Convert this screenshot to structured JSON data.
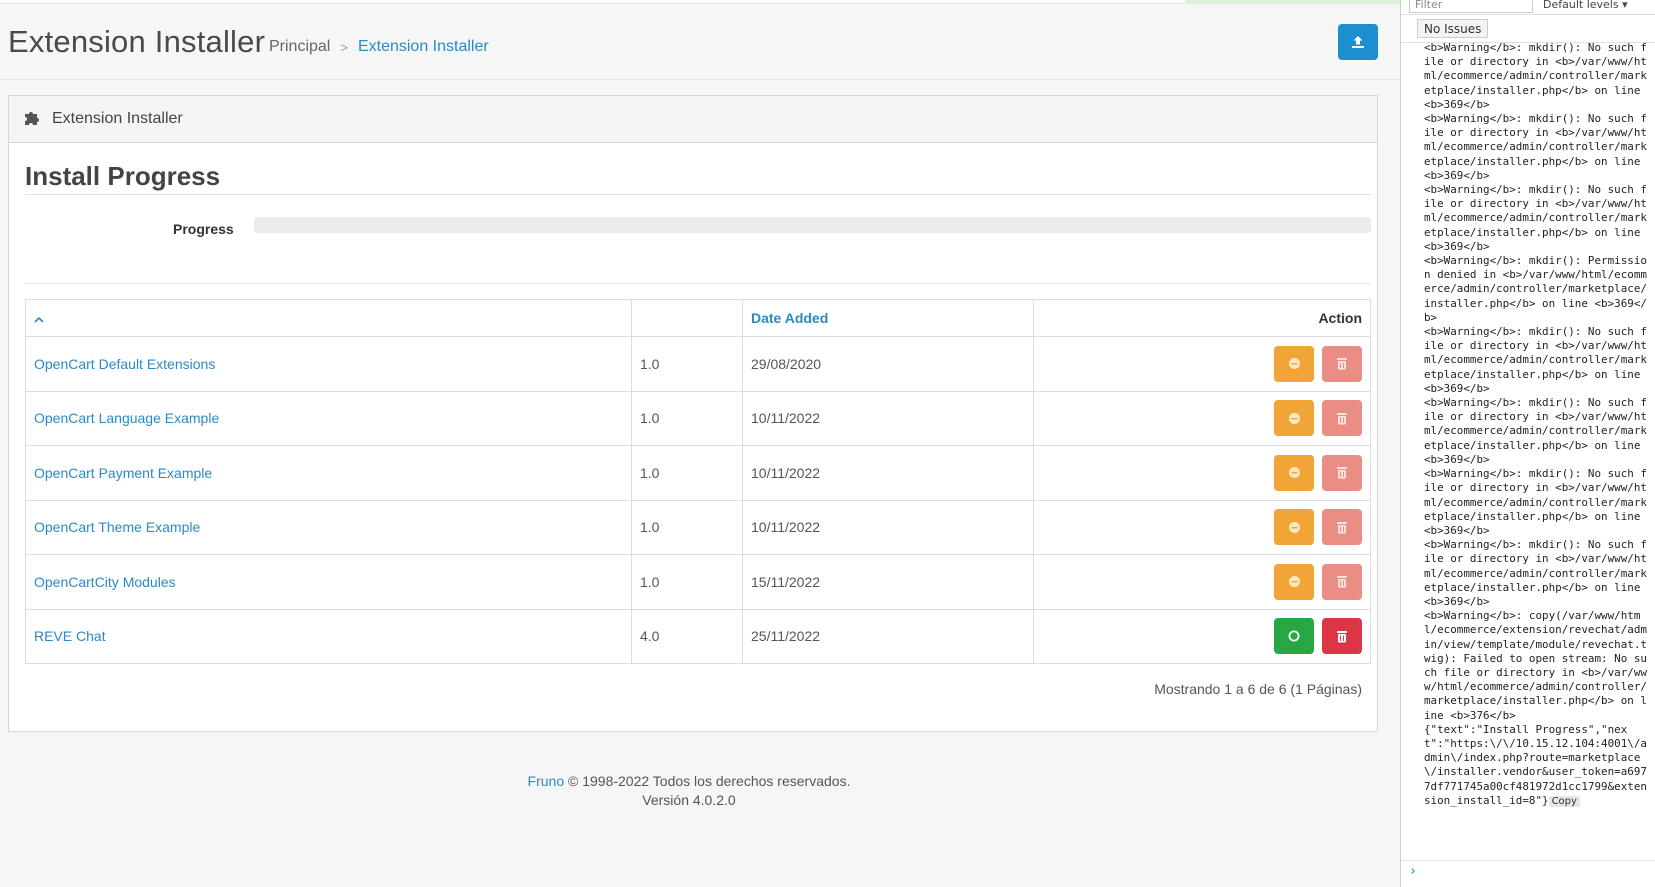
{
  "header": {
    "title": "Extension Installer",
    "breadcrumb": [
      {
        "label": "Principal"
      },
      {
        "label": "Extension Installer"
      }
    ],
    "upload_icon": "upload-icon"
  },
  "card": {
    "header_title": "Extension Installer",
    "header_icon": "puzzle-icon",
    "section_title": "Install Progress",
    "progress_label": "Progress",
    "progress_value": 0
  },
  "table": {
    "columns": {
      "name_sort_icon": "chevron-up-icon",
      "version": "",
      "date_added": "Date Added",
      "action": "Action"
    },
    "rows": [
      {
        "name": "OpenCart Default Extensions",
        "version": "1.0",
        "date": "29/08/2020",
        "installed": false
      },
      {
        "name": "OpenCart Language Example",
        "version": "1.0",
        "date": "10/11/2022",
        "installed": false
      },
      {
        "name": "OpenCart Payment Example",
        "version": "1.0",
        "date": "10/11/2022",
        "installed": false
      },
      {
        "name": "OpenCart Theme Example",
        "version": "1.0",
        "date": "10/11/2022",
        "installed": false
      },
      {
        "name": "OpenCartCity Modules",
        "version": "1.0",
        "date": "15/11/2022",
        "installed": false
      },
      {
        "name": "REVE Chat",
        "version": "4.0",
        "date": "25/11/2022",
        "installed": true
      }
    ],
    "pagination_info": "Mostrando 1 a 6 de 6 (1 Páginas)"
  },
  "footer": {
    "brand_link": "Fruno",
    "copyright": "© 1998-2022 Todos los derechos reservados.",
    "version": "Versión 4.0.2.0"
  },
  "devtools": {
    "filter_placeholder": "Filter",
    "levels": "Default levels ▾",
    "issues": "No Issues",
    "log_text": "<b>Warning</b>: mkdir(): No such file or directory in <b>/var/www/html/ecommerce/admin/controller/marketplace/installer.php</b> on line <b>369</b>\n<b>Warning</b>: mkdir(): No such file or directory in <b>/var/www/html/ecommerce/admin/controller/marketplace/installer.php</b> on line <b>369</b>\n<b>Warning</b>: mkdir(): No such file or directory in <b>/var/www/html/ecommerce/admin/controller/marketplace/installer.php</b> on line <b>369</b>\n<b>Warning</b>: mkdir(): Permission denied in <b>/var/www/html/ecommerce/admin/controller/marketplace/installer.php</b> on line <b>369</b>\n<b>Warning</b>: mkdir(): No such file or directory in <b>/var/www/html/ecommerce/admin/controller/marketplace/installer.php</b> on line <b>369</b>\n<b>Warning</b>: mkdir(): No such file or directory in <b>/var/www/html/ecommerce/admin/controller/marketplace/installer.php</b> on line <b>369</b>\n<b>Warning</b>: mkdir(): No such file or directory in <b>/var/www/html/ecommerce/admin/controller/marketplace/installer.php</b> on line <b>369</b>\n<b>Warning</b>: mkdir(): No such file or directory in <b>/var/www/html/ecommerce/admin/controller/marketplace/installer.php</b> on line <b>369</b>\n<b>Warning</b>: copy(/var/www/html/ecommerce/extension/revechat/admin/view/template/module/revechat.twig): Failed to open stream: No such file or directory in <b>/var/www/html/ecommerce/admin/controller/marketplace/installer.php</b> on line <b>376</b>\n{\"text\":\"Install Progress\",\"next\":\"https:\\/\\/10.15.12.104:4001\\/admin\\/index.php?route=marketplace\\/installer.vendor&user_token=a6977df771745a00cf481972d1cc1799&extension_install_id=8\"}",
    "copy_label": "Copy",
    "prompt": "›"
  }
}
